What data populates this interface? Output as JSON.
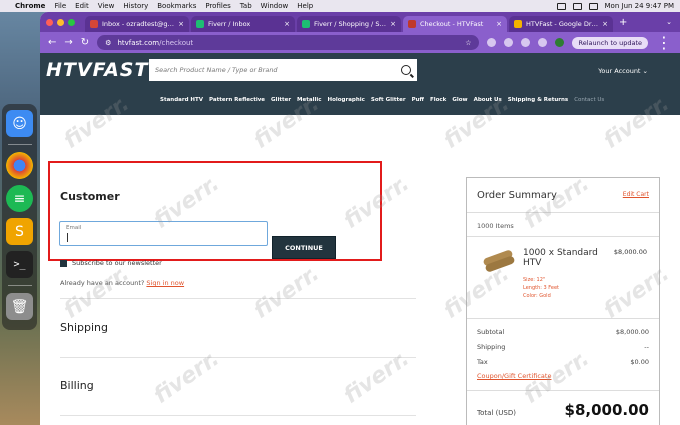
{
  "menubar": {
    "apple": "",
    "app": "Chrome",
    "items": [
      "File",
      "Edit",
      "View",
      "History",
      "Bookmarks",
      "Profiles",
      "Tab",
      "Window",
      "Help"
    ],
    "clock": "Mon Jun 24  9:47 PM"
  },
  "tabs": [
    {
      "label": "Inbox - ozradtest@gmail.com",
      "color": "#d44638"
    },
    {
      "label": "Fiverr / Inbox",
      "color": "#1dbf73"
    },
    {
      "label": "Fiverr / Shopping / Status of",
      "color": "#1dbf73"
    },
    {
      "label": "Checkout - HTVFast",
      "color": "#c0392b"
    },
    {
      "label": "HTVFast - Google Drive",
      "color": "#f4b400"
    }
  ],
  "address": {
    "host": "htvfast.com",
    "path": "/checkout"
  },
  "relaunch_label": "Relaunch to update",
  "site": {
    "logo": "HTVFAST",
    "search_placeholder": "Search Product Name / Type or Brand",
    "account": "Your Account ⌄",
    "categories": [
      "Standard HTV",
      "Pattern Reflective",
      "Glitter",
      "Metallic",
      "Holographic",
      "Soft Glitter",
      "Puff",
      "Flock",
      "Glow",
      "About Us",
      "Shipping & Returns"
    ],
    "categories_dim": "Contact Us"
  },
  "checkout": {
    "customer_title": "Customer",
    "email_label": "Email",
    "continue_label": "CONTINUE",
    "newsletter_label": "Subscribe to our newsletter",
    "signin_text": "Already have an account?",
    "signin_link": "Sign in now",
    "shipping_title": "Shipping",
    "billing_title": "Billing"
  },
  "summary": {
    "title": "Order Summary",
    "edit_cart": "Edit Cart",
    "items_count": "1000 Items",
    "product_name": "1000 x Standard HTV",
    "product_price": "$8,000.00",
    "options": [
      "Size: 12\"",
      "Length: 3 Feet",
      "Color: Gold"
    ],
    "subtotal_label": "Subtotal",
    "subtotal_value": "$8,000.00",
    "shipping_label": "Shipping",
    "shipping_value": "--",
    "tax_label": "Tax",
    "tax_value": "$0.00",
    "coupon_label": "Coupon/Gift Certificate",
    "total_label": "Total (USD)",
    "total_value": "$8,000.00"
  },
  "watermark": "fiverr."
}
